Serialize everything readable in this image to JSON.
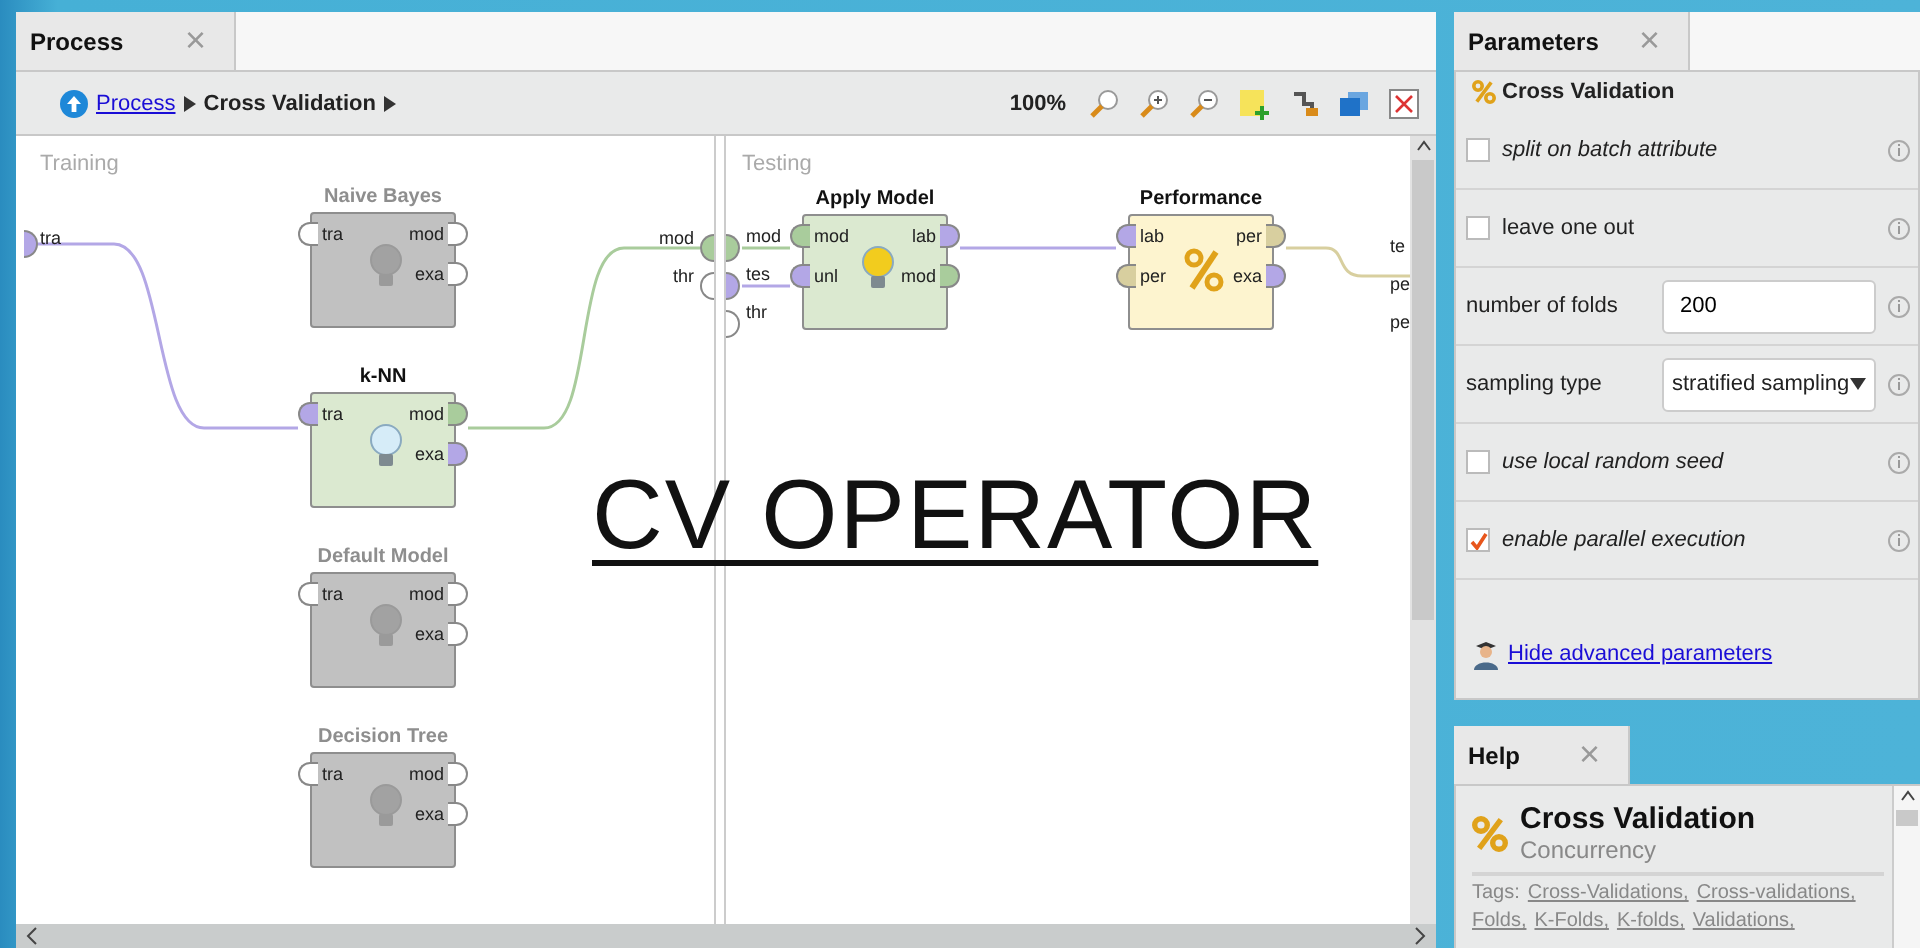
{
  "process_tab": {
    "title": "Process",
    "close": "×"
  },
  "breadcrumb": {
    "root": "Process",
    "current": "Cross Validation"
  },
  "toolbar": {
    "zoom": "100%"
  },
  "training": {
    "label": "Training",
    "left_ports": [
      {
        "label": "tra",
        "color": "#b3a7e6"
      }
    ],
    "right_ports": [
      {
        "label": "mod",
        "color": "#a9cc9c"
      },
      {
        "label": "thr",
        "color": "#ffffff"
      }
    ],
    "operators": [
      {
        "name": "Naive Bayes",
        "kind": "model",
        "disabled": true,
        "inputs": [
          {
            "label": "tra",
            "color": "#ffffff"
          }
        ],
        "outputs": [
          {
            "label": "mod",
            "color": "#ffffff"
          },
          {
            "label": "exa",
            "color": "#ffffff"
          }
        ]
      },
      {
        "name": "k-NN",
        "kind": "model",
        "disabled": false,
        "inputs": [
          {
            "label": "tra",
            "color": "#b3a7e6"
          }
        ],
        "outputs": [
          {
            "label": "mod",
            "color": "#a9cc9c"
          },
          {
            "label": "exa",
            "color": "#b3a7e6"
          }
        ]
      },
      {
        "name": "Default Model",
        "kind": "model",
        "disabled": true,
        "inputs": [
          {
            "label": "tra",
            "color": "#ffffff"
          }
        ],
        "outputs": [
          {
            "label": "mod",
            "color": "#ffffff"
          },
          {
            "label": "exa",
            "color": "#ffffff"
          }
        ]
      },
      {
        "name": "Decision Tree",
        "kind": "model",
        "disabled": true,
        "inputs": [
          {
            "label": "tra",
            "color": "#ffffff"
          }
        ],
        "outputs": [
          {
            "label": "mod",
            "color": "#ffffff"
          },
          {
            "label": "exa",
            "color": "#ffffff"
          }
        ]
      }
    ]
  },
  "testing": {
    "label": "Testing",
    "left_ports": [
      {
        "label": "mod",
        "color": "#a9cc9c"
      },
      {
        "label": "tes",
        "color": "#b3a7e6"
      },
      {
        "label": "thr",
        "color": "#ffffff"
      }
    ],
    "right_ports": [
      {
        "label": "te"
      },
      {
        "label": "pe"
      },
      {
        "label": "pe"
      }
    ],
    "operators": [
      {
        "name": "Apply Model",
        "kind": "apply",
        "disabled": false,
        "inputs": [
          {
            "label": "mod",
            "color": "#a9cc9c"
          },
          {
            "label": "unl",
            "color": "#b3a7e6"
          }
        ],
        "outputs": [
          {
            "label": "lab",
            "color": "#b3a7e6"
          },
          {
            "label": "mod",
            "color": "#a9cc9c"
          }
        ]
      },
      {
        "name": "Performance",
        "kind": "evaluation",
        "disabled": false,
        "inputs": [
          {
            "label": "lab",
            "color": "#b3a7e6"
          },
          {
            "label": "per",
            "color": "#d8cf9f"
          }
        ],
        "outputs": [
          {
            "label": "per",
            "color": "#d8cf9f"
          },
          {
            "label": "exa",
            "color": "#b3a7e6"
          }
        ]
      }
    ]
  },
  "overlay_title": "CV OPERATOR",
  "parameters_tab": {
    "title": "Parameters",
    "close": "×"
  },
  "parameters": {
    "operator": "Cross Validation",
    "rows": [
      {
        "kind": "checkbox",
        "label": "split on batch attribute",
        "expert": true,
        "checked": false
      },
      {
        "kind": "checkbox",
        "label": "leave one out",
        "expert": false,
        "checked": false
      },
      {
        "kind": "number",
        "label": "number of folds",
        "expert": false,
        "value": "200"
      },
      {
        "kind": "select",
        "label": "sampling type",
        "expert": false,
        "value": "stratified sampling"
      },
      {
        "kind": "checkbox",
        "label": "use local random seed",
        "expert": true,
        "checked": false
      },
      {
        "kind": "checkbox",
        "label": "enable parallel execution",
        "expert": true,
        "checked": true
      }
    ],
    "advanced_link": "Hide advanced parameters"
  },
  "help_tab": {
    "title": "Help",
    "close": "×"
  },
  "help": {
    "title": "Cross Validation",
    "group": "Concurrency",
    "tags_label": "Tags:",
    "tags": [
      "Cross-Validations,",
      "Cross-validations,",
      "Folds,",
      "K-Folds,",
      "K-folds,",
      "Validations,"
    ]
  }
}
